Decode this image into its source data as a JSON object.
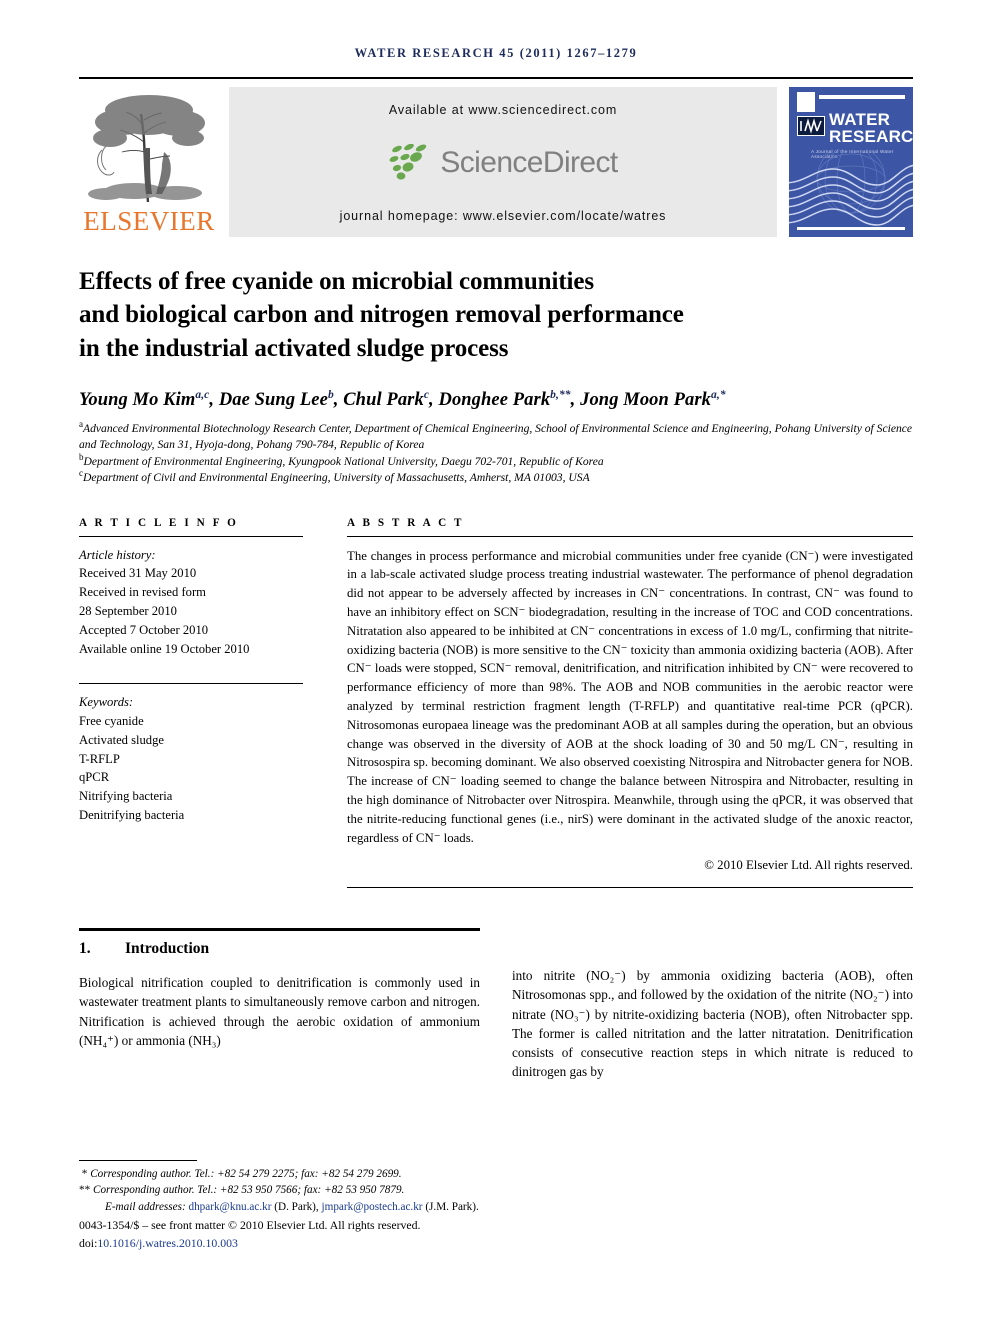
{
  "running_head": "WATER RESEARCH 45 (2011) 1267–1279",
  "masthead": {
    "elsevier_wordmark": "ELSEVIER",
    "available_at": "Available at www.sciencedirect.com",
    "sciencedirect_wordmark": "ScienceDirect",
    "journal_homepage": "journal homepage: www.elsevier.com/locate/watres",
    "cover": {
      "title_line1": "WATER",
      "title_line2": "RESEARCH",
      "iwa_label": "IWA",
      "tagline": "A Journal of the International Water Association"
    }
  },
  "article": {
    "title_line1": "Effects of free cyanide on microbial communities",
    "title_line2": "and biological carbon and nitrogen removal performance",
    "title_line3": "in the industrial activated sludge process",
    "authors": [
      {
        "name": "Young Mo Kim",
        "sup": "a,c"
      },
      {
        "name": "Dae Sung Lee",
        "sup": "b"
      },
      {
        "name": "Chul Park",
        "sup": "c"
      },
      {
        "name": "Donghee Park",
        "sup": "b,**"
      },
      {
        "name": "Jong Moon Park",
        "sup": "a,*"
      }
    ],
    "affiliations": [
      {
        "marker": "a",
        "text": "Advanced Environmental Biotechnology Research Center, Department of Chemical Engineering, School of Environmental Science and Engineering, Pohang University of Science and Technology, San 31, Hyoja-dong, Pohang 790-784, Republic of Korea"
      },
      {
        "marker": "b",
        "text": "Department of Environmental Engineering, Kyungpook National University, Daegu 702-701, Republic of Korea"
      },
      {
        "marker": "c",
        "text": "Department of Civil and Environmental Engineering, University of Massachusetts, Amherst, MA 01003, USA"
      }
    ]
  },
  "article_info": {
    "heading": "A R T I C L E   I N F O",
    "history_label": "Article history:",
    "history": [
      "Received 31 May 2010",
      "Received in revised form",
      "28 September 2010",
      "Accepted 7 October 2010",
      "Available online 19 October 2010"
    ],
    "keywords_label": "Keywords:",
    "keywords": [
      "Free cyanide",
      "Activated sludge",
      "T-RFLP",
      "qPCR",
      "Nitrifying bacteria",
      "Denitrifying bacteria"
    ]
  },
  "abstract": {
    "heading": "A B S T R A C T",
    "paragraph": "The changes in process performance and microbial communities under free cyanide (CN⁻) were investigated in a lab-scale activated sludge process treating industrial wastewater. The performance of phenol degradation did not appear to be adversely affected by increases in CN⁻ concentrations. In contrast, CN⁻ was found to have an inhibitory effect on SCN⁻ biodegradation, resulting in the increase of TOC and COD concentrations. Nitratation also appeared to be inhibited at CN⁻ concentrations in excess of 1.0 mg/L, confirming that nitrite-oxidizing bacteria (NOB) is more sensitive to the CN⁻ toxicity than ammonia oxidizing bacteria (AOB). After CN⁻ loads were stopped, SCN⁻ removal, denitrification, and nitrification inhibited by CN⁻ were recovered to performance efficiency of more than 98%. The AOB and NOB communities in the aerobic reactor were analyzed by terminal restriction fragment length (T-RFLP) and quantitative real-time PCR (qPCR). Nitrosomonas europaea lineage was the predominant AOB at all samples during the operation, but an obvious change was observed in the diversity of AOB at the shock loading of 30 and 50 mg/L CN⁻, resulting in Nitrosospira sp. becoming dominant. We also observed coexisting Nitrospira and Nitrobacter genera for NOB. The increase of CN⁻ loading seemed to change the balance between Nitrospira and Nitrobacter, resulting in the high dominance of Nitrobacter over Nitrospira. Meanwhile, through using the qPCR, it was observed that the nitrite-reducing functional genes (i.e., nirS) were dominant in the activated sludge of the anoxic reactor, regardless of CN⁻ loads.",
    "copyright": "© 2010 Elsevier Ltd. All rights reserved."
  },
  "introduction": {
    "number": "1.",
    "heading": "Introduction",
    "left_paragraph": "Biological nitrification coupled to denitrification is commonly used in wastewater treatment plants to simultaneously remove carbon and nitrogen. Nitrification is achieved through the aerobic oxidation of ammonium (NH₄⁺) or ammonia (NH₃)",
    "right_paragraph": "into nitrite (NO₂⁻) by ammonia oxidizing bacteria (AOB), often Nitrosomonas spp., and followed by the oxidation of the nitrite (NO₂⁻) into nitrate (NO₃⁻) by nitrite-oxidizing bacteria (NOB), often Nitrobacter spp. The former is called nitritation and the latter nitratation. Denitrification consists of consecutive reaction steps in which nitrate is reduced to dinitrogen gas by"
  },
  "footnotes": {
    "corresponding1": "Corresponding author. Tel.: +82 54 279 2275; fax: +82 54 279 2699.",
    "corresponding2": "Corresponding author. Tel.: +82 53 950 7566; fax: +82 53 950 7879.",
    "email_label": "E-mail addresses:",
    "email1": "dhpark@knu.ac.kr",
    "email1_who": "(D. Park),",
    "email2": "jmpark@postech.ac.kr",
    "email2_who": "(J.M. Park).",
    "front_matter": "0043-1354/$ – see front matter © 2010 Elsevier Ltd. All rights reserved.",
    "doi_label": "doi:",
    "doi": "10.1016/j.watres.2010.10.003"
  },
  "colors": {
    "running_head": "#1d2b5c",
    "elsevier_orange": "#E8762C",
    "sciencedirect_gray": "#808080",
    "sciencedirect_green": "#6aa84f",
    "cover_blue": "#3c55a5",
    "link_blue": "#1a3a8f"
  }
}
